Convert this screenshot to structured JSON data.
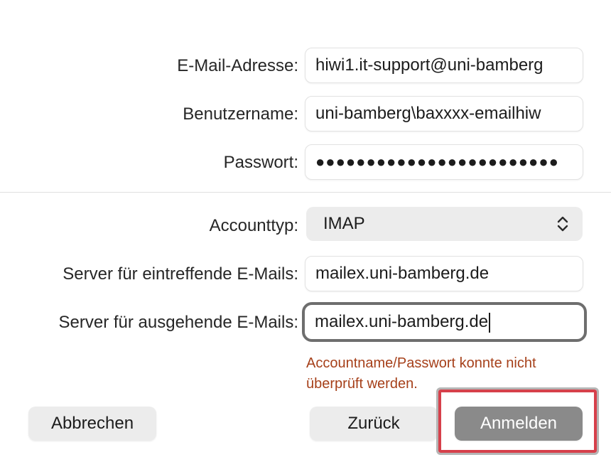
{
  "form": {
    "email": {
      "label": "E-Mail-Adresse:",
      "value": "hiwi1.it-support@uni-bamberg"
    },
    "username": {
      "label": "Benutzername:",
      "value": "uni-bamberg\\baxxxx-emailhiw"
    },
    "password": {
      "label": "Passwort:",
      "value": "●●●●●●●●●●●●●●●●●●●●●●●●"
    },
    "account_type": {
      "label": "Accounttyp:",
      "value": "IMAP"
    },
    "incoming_server": {
      "label": "Server für eintreffende E-Mails:",
      "value": "mailex.uni-bamberg.de"
    },
    "outgoing_server": {
      "label": "Server für ausgehende E-Mails:",
      "value": "mailex.uni-bamberg.de"
    }
  },
  "error": {
    "line1": "Accountname/Passwort konnte nicht",
    "line2": "überprüft werden."
  },
  "buttons": {
    "cancel": "Abbrechen",
    "back": "Zurück",
    "sign_in": "Anmelden"
  },
  "colors": {
    "error_text": "#a6401a",
    "primary_button": "#8a8a8a",
    "highlight": "#d6404b"
  },
  "icons": {
    "popup_chevron": "chevron-up-down-icon"
  }
}
